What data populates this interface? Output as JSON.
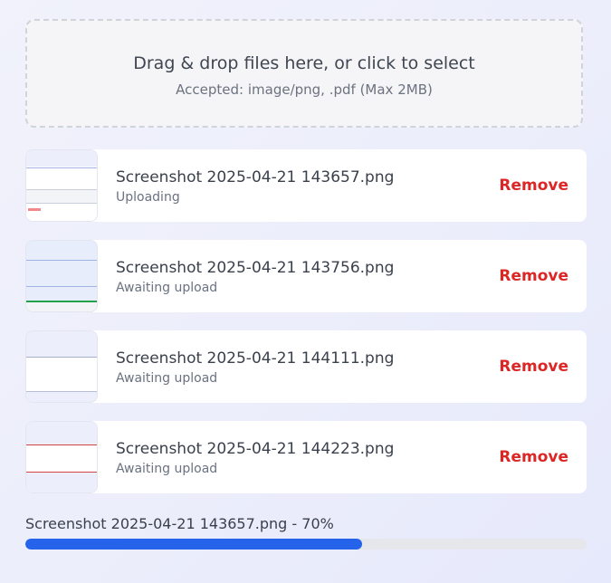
{
  "dropzone": {
    "main_text": "Drag & drop files here, or click to select",
    "sub_text": "Accepted: image/png, .pdf (Max 2MB)"
  },
  "files": [
    {
      "name": "Screenshot 2025-04-21 143657.png",
      "status": "Uploading",
      "remove_label": "Remove"
    },
    {
      "name": "Screenshot 2025-04-21 143756.png",
      "status": "Awaiting upload",
      "remove_label": "Remove"
    },
    {
      "name": "Screenshot 2025-04-21 144111.png",
      "status": "Awaiting upload",
      "remove_label": "Remove"
    },
    {
      "name": "Screenshot 2025-04-21 144223.png",
      "status": "Awaiting upload",
      "remove_label": "Remove"
    }
  ],
  "progress": {
    "label": "Screenshot 2025-04-21 143657.png - 70%",
    "percent": 60
  },
  "colors": {
    "remove": "#dc2626",
    "progress_fill": "#2563eb",
    "progress_track": "#e5e7eb"
  }
}
